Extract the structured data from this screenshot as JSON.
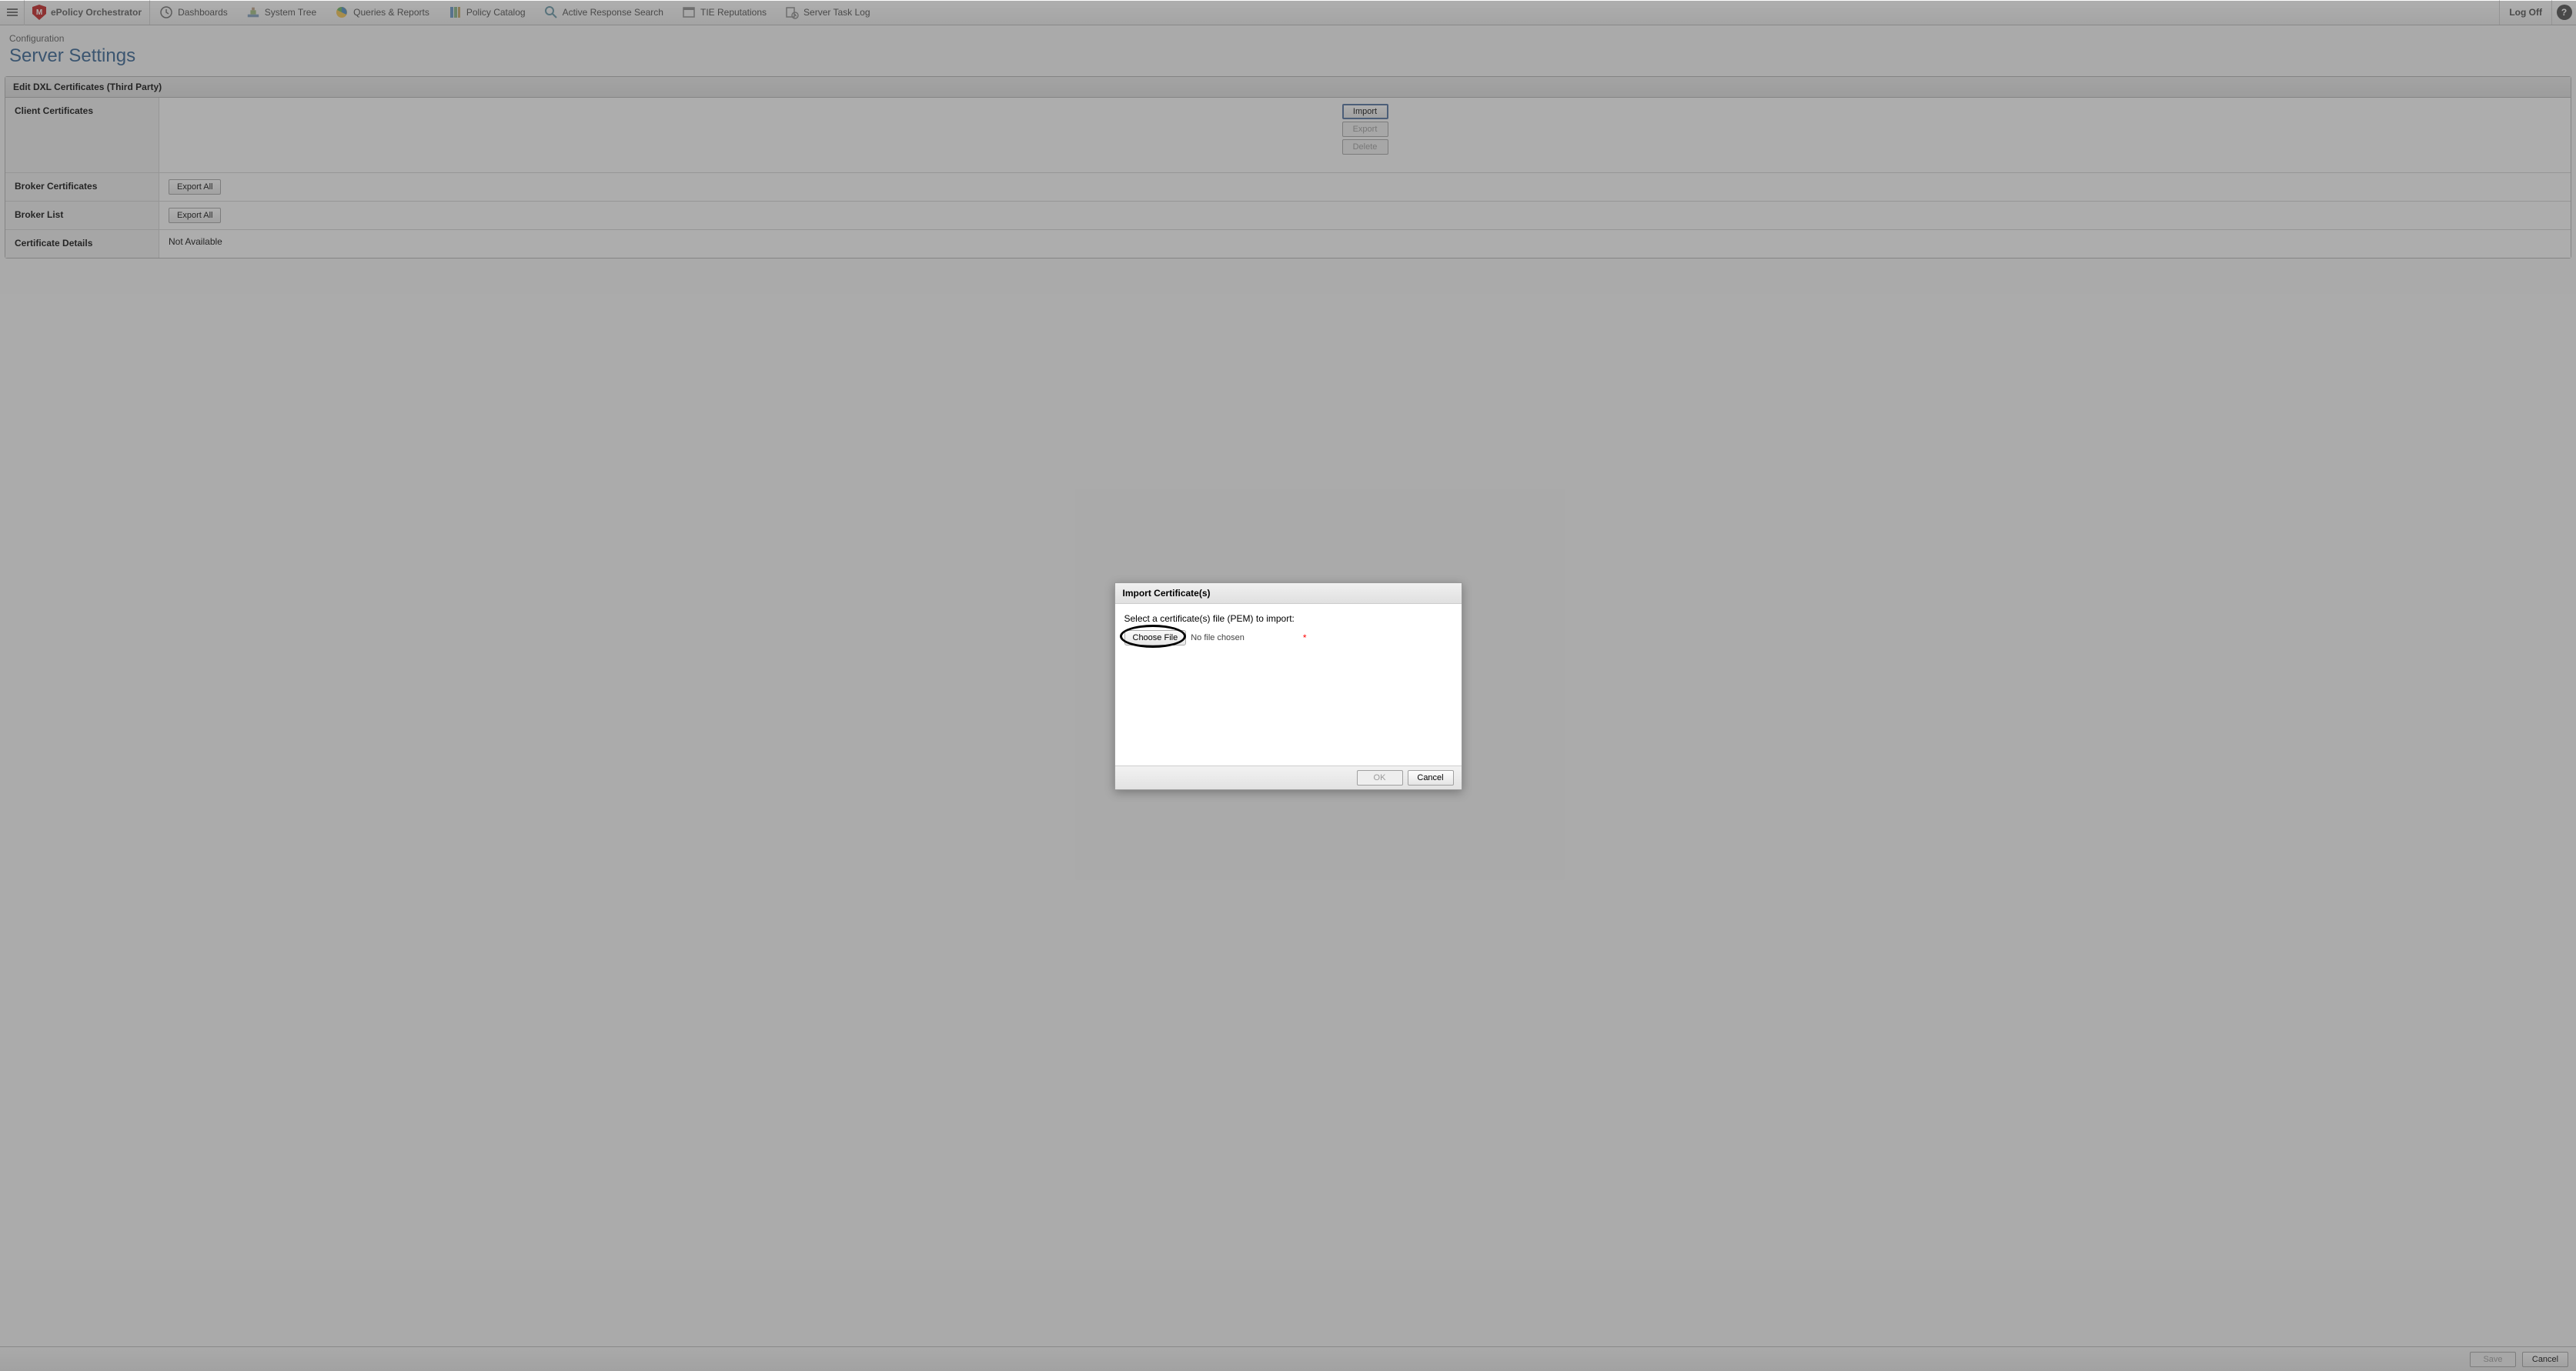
{
  "header": {
    "product_name": "ePolicy Orchestrator",
    "nav_items": [
      {
        "label": "Dashboards",
        "icon": "clock"
      },
      {
        "label": "System Tree",
        "icon": "tree"
      },
      {
        "label": "Queries & Reports",
        "icon": "chart"
      },
      {
        "label": "Policy Catalog",
        "icon": "catalog"
      },
      {
        "label": "Active Response Search",
        "icon": "search"
      },
      {
        "label": "TIE Reputations",
        "icon": "window"
      },
      {
        "label": "Server Task Log",
        "icon": "tasklog"
      }
    ],
    "logoff": "Log Off"
  },
  "breadcrumb": "Configuration",
  "page_title": "Server Settings",
  "panel": {
    "title": "Edit DXL Certificates (Third Party)",
    "rows": {
      "client_certs_label": "Client Certificates",
      "client_certs_buttons": {
        "import": "Import",
        "export": "Export",
        "delete": "Delete"
      },
      "broker_certs_label": "Broker Certificates",
      "broker_certs_export_all": "Export All",
      "broker_list_label": "Broker List",
      "broker_list_export_all": "Export All",
      "cert_details_label": "Certificate Details",
      "cert_details_value": "Not Available"
    }
  },
  "footer": {
    "save": "Save",
    "cancel": "Cancel"
  },
  "modal": {
    "title": "Import Certificate(s)",
    "prompt": "Select a certificate(s) file (PEM) to import:",
    "choose_file": "Choose File",
    "no_file": "No file chosen",
    "ok": "OK",
    "cancel": "Cancel"
  }
}
